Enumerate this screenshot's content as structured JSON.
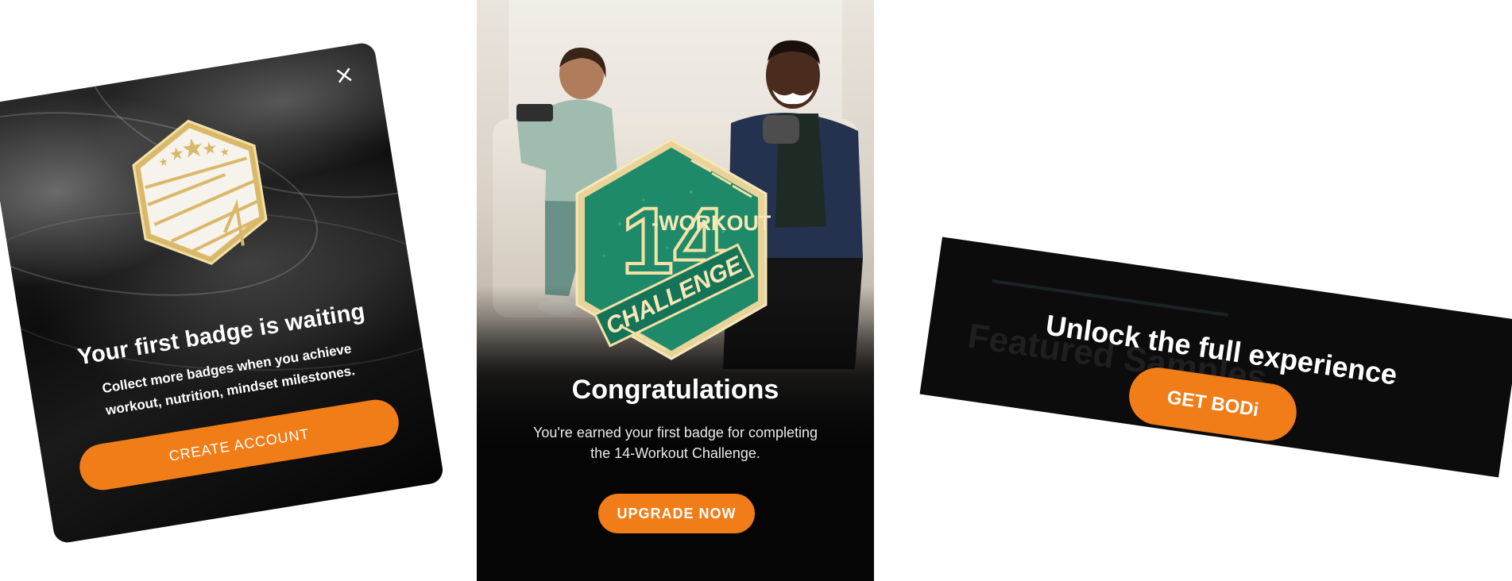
{
  "modal_badge": {
    "close_glyph": "×",
    "title": "Your first badge is waiting",
    "description": "Collect more badges when you achieve workout, nutrition, mindset milestones.",
    "cta_label": "CREATE ACCOUNT",
    "badge_icon": "five-star-badge-icon",
    "accent": "#f07d18"
  },
  "modal_congrats": {
    "badge_text_top": "-WORKOUT",
    "badge_number": "14",
    "badge_text_bottom": "CHALLENGE",
    "title": "Congratulations",
    "description": "You're earned your first badge for completing the 14-Workout Challenge.",
    "cta_label": "UPGRADE NOW",
    "accent": "#f07d18",
    "badge_color": "#1f8a6a"
  },
  "modal_unlock": {
    "background_text": "Featured Samples",
    "title": "Unlock the full experience",
    "cta_label": "GET BODi",
    "accent": "#f07d18"
  }
}
